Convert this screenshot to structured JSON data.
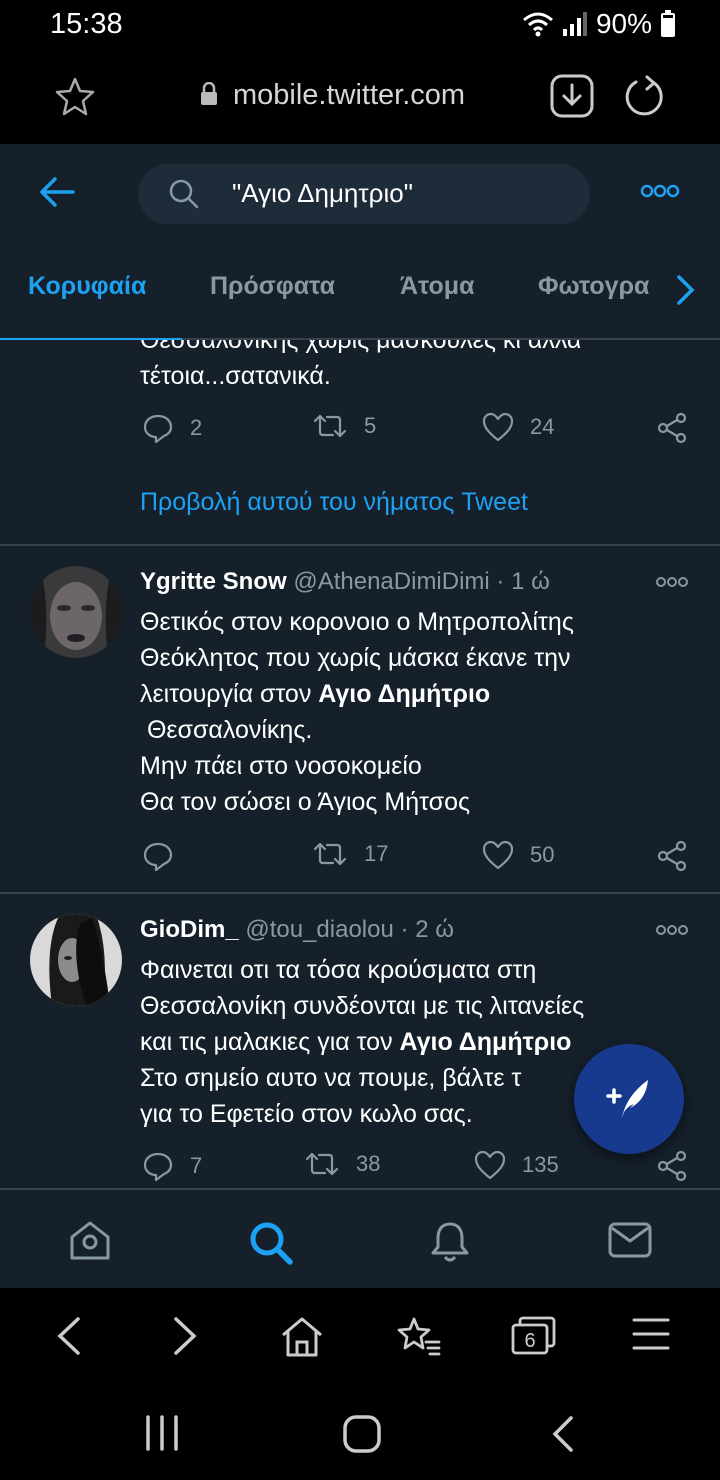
{
  "status_bar": {
    "time": "15:38",
    "battery": "90%"
  },
  "browser": {
    "url": "mobile.twitter.com",
    "tabs_count": "6"
  },
  "search": {
    "query": "\"Αγιο Δημητριο\""
  },
  "tabs": [
    {
      "label": "Κορυφαία",
      "active": true
    },
    {
      "label": "Πρόσφατα"
    },
    {
      "label": "Άτομα"
    },
    {
      "label": "Φωτογρα"
    }
  ],
  "top_tweet": {
    "cut_line": "Θεσσαλονίκης χωρίς μάσκουλες κι άλλα",
    "last_line": "τέτοια...σατανικά.",
    "replies": "2",
    "retweets": "5",
    "likes": "24",
    "show_thread": "Προβολή αυτού του νήματος Tweet"
  },
  "tweets": [
    {
      "name": "Ygritte Snow",
      "handle": "@AthenaDimiDimi",
      "time": "1 ώ",
      "line1": "Θετικός στον κορονοιο ο Μητροπολίτης",
      "line2": "Θεόκλητος που χωρίς μάσκα έκανε την",
      "line3_pre": "λειτουργία στον ",
      "line3_hl": "Αγιο Δημήτριο",
      "line4": " Θεσσαλονίκης.",
      "line5": "Μην πάει στο νοσοκομείο",
      "line6": "Θα τον σώσει ο Άγιος Μήτσος",
      "replies": "",
      "retweets": "17",
      "likes": "50"
    },
    {
      "name": "GioDim_",
      "handle": "@tou_diaolou",
      "time": "2 ώ",
      "line1": "Φαινεται οτι τα τόσα κρούσματα στη",
      "line2": "Θεσσαλονίκη συνδέονται με τις λιτανείες",
      "line3_pre": "και τις μαλακιες για τον ",
      "line3_hl": "Αγιο Δημήτριο",
      "line4": "Στο σημείο αυτο να πουμε, βάλτε τ",
      "line5": "για το Εφετείο στον κωλο σας.",
      "replies": "7",
      "retweets": "38",
      "likes": "135"
    }
  ],
  "colors": {
    "background": "#15202b",
    "accent": "#1da1f2",
    "muted": "#8899a6",
    "divider": "#38444d"
  }
}
